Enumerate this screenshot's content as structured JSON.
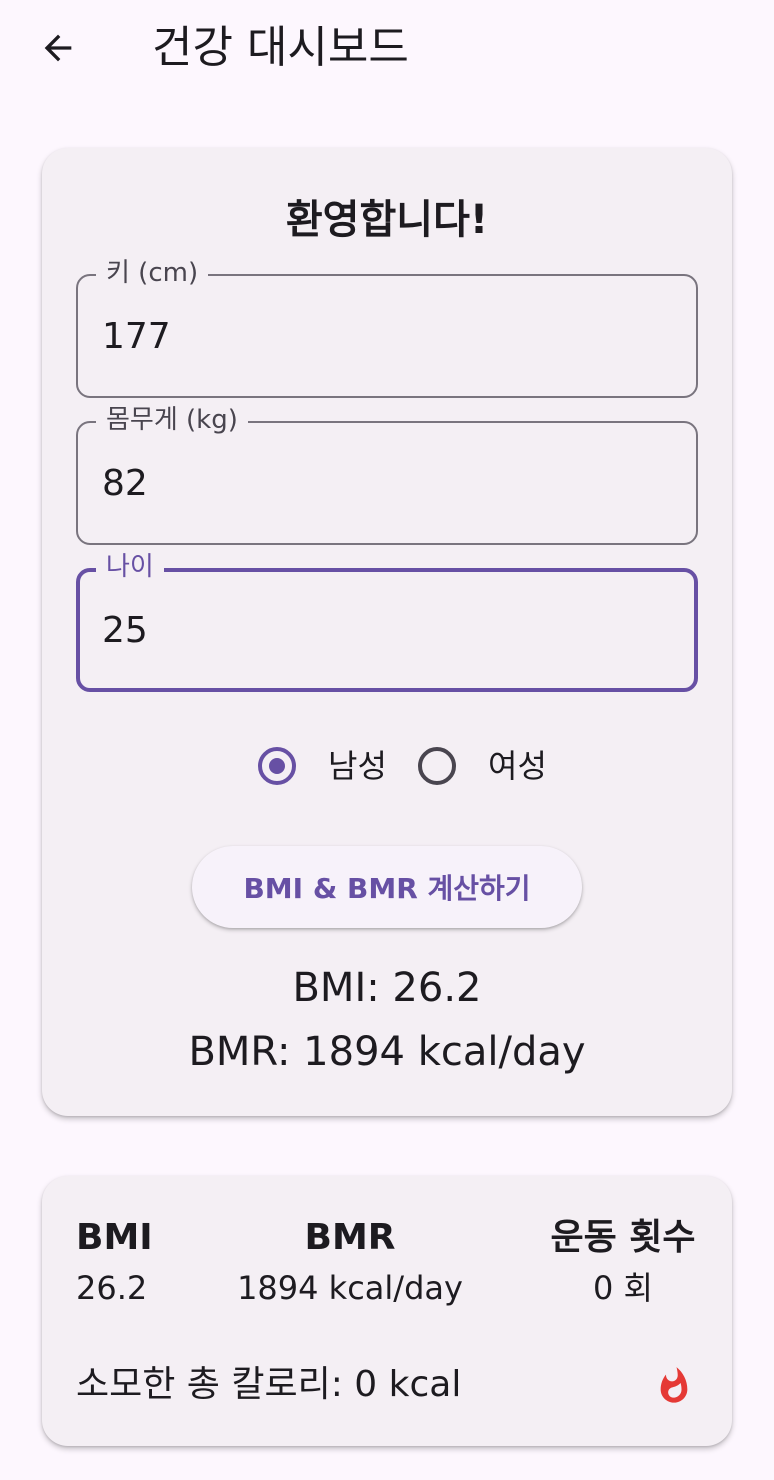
{
  "app_bar": {
    "title": "건강 대시보드",
    "back_icon": "arrow-back-icon"
  },
  "main_card": {
    "welcome": "환영합니다!",
    "fields": {
      "height": {
        "label": "키 (cm)",
        "value": "177"
      },
      "weight": {
        "label": "몸무게 (kg)",
        "value": "82"
      },
      "age": {
        "label": "나이",
        "value": "25"
      }
    },
    "gender": {
      "options": [
        {
          "label": "남성",
          "selected": true
        },
        {
          "label": "여성",
          "selected": false
        }
      ]
    },
    "calc_button": "BMI & BMR 계산하기",
    "result_bmi": "BMI: 26.2",
    "result_bmr": "BMR: 1894 kcal/day"
  },
  "stats_card": {
    "bmi_label": "BMI",
    "bmi_value": "26.2",
    "bmr_label": "BMR",
    "bmr_value": "1894 kcal/day",
    "exercise_label": "운동 횟수",
    "exercise_value": "0 회",
    "total_calories": "소모한 총 칼로리: 0 kcal",
    "fire_icon": "fire-icon"
  },
  "colors": {
    "primary": "#6750a4",
    "background": "#fdf7fe",
    "card": "#f4eff4",
    "fire": "#e53935"
  }
}
